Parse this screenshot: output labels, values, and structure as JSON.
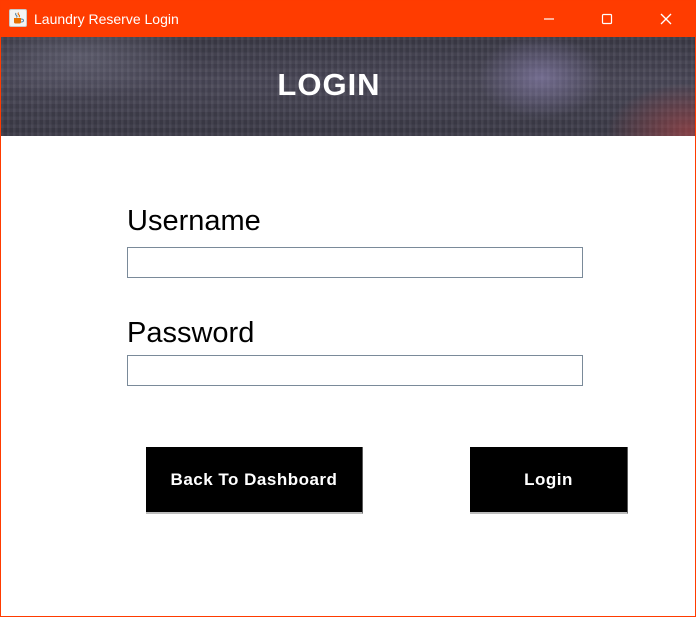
{
  "window": {
    "title": "Laundry Reserve Login",
    "accent_color": "#ff3c00",
    "icon": "java-cup-icon",
    "controls": [
      "minimize-icon",
      "maximize-icon",
      "close-icon"
    ]
  },
  "header": {
    "title": "LOGIN"
  },
  "form": {
    "username_label": "Username",
    "username_value": "",
    "password_label": "Password",
    "password_value": ""
  },
  "actions": {
    "back_label": "Back To Dashboard",
    "login_label": "Login",
    "button_color": "#000000"
  }
}
